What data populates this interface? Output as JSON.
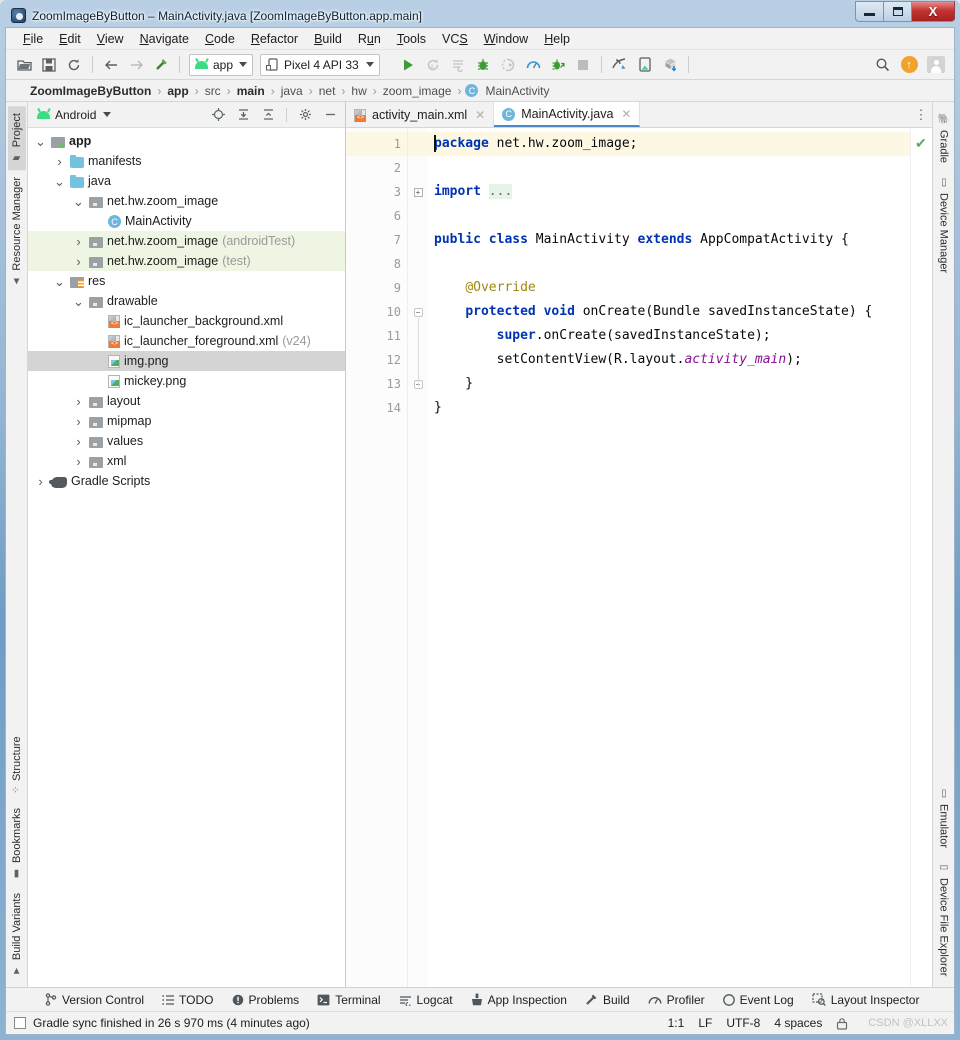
{
  "window": {
    "title": "ZoomImageByButton – MainActivity.java [ZoomImageByButton.app.main]",
    "minimize_label": "Minimize",
    "maximize_label": "Maximize",
    "close_label": "X"
  },
  "menubar": [
    {
      "label": "File",
      "mnemonic": "F"
    },
    {
      "label": "Edit",
      "mnemonic": "E"
    },
    {
      "label": "View",
      "mnemonic": "V"
    },
    {
      "label": "Navigate",
      "mnemonic": "N"
    },
    {
      "label": "Code",
      "mnemonic": "C"
    },
    {
      "label": "Refactor",
      "mnemonic": "R"
    },
    {
      "label": "Build",
      "mnemonic": "B"
    },
    {
      "label": "Run",
      "mnemonic": "u"
    },
    {
      "label": "Tools",
      "mnemonic": "T"
    },
    {
      "label": "VCS",
      "mnemonic": "S"
    },
    {
      "label": "Window",
      "mnemonic": "W"
    },
    {
      "label": "Help",
      "mnemonic": "H"
    }
  ],
  "toolbar": {
    "open_label": "Open",
    "save_label": "Save All",
    "sync_label": "Sync Project with Gradle Files",
    "back_label": "Back",
    "forward_label": "Forward",
    "build_label": "Make Project",
    "module_selector": "app",
    "device_selector": "Pixel 4 API 33",
    "run_label": "Run",
    "rerun_label": "Apply Changes",
    "logcat_label": "Attach Debugger",
    "debug_label": "Debug",
    "run_coverage_label": "Run with Coverage",
    "profile_label": "Profile",
    "attach_label": "Attach Debugger to Android Process",
    "stop_label": "Stop",
    "avd_label": "Device Manager",
    "sdk_label": "SDK Manager",
    "gradle_sync_label": "Sync Project",
    "search_label": "Search Everywhere",
    "update_label": "Update",
    "account_label": "Account"
  },
  "breadcrumb": [
    {
      "label": "ZoomImageByButton",
      "bold": true
    },
    {
      "label": "app",
      "bold": true
    },
    {
      "label": "src",
      "bold": false
    },
    {
      "label": "main",
      "bold": true
    },
    {
      "label": "java",
      "bold": false
    },
    {
      "label": "net",
      "bold": false
    },
    {
      "label": "hw",
      "bold": false
    },
    {
      "label": "zoom_image",
      "bold": false
    },
    {
      "label": "MainActivity",
      "bold": false,
      "badge": "C"
    }
  ],
  "left_rail": {
    "top": [
      {
        "label": "Project",
        "icon": "folder-icon",
        "active": true
      },
      {
        "label": "Resource Manager",
        "icon": "resource-icon",
        "active": false
      }
    ],
    "bottom": [
      {
        "label": "Structure",
        "icon": "structure-icon"
      },
      {
        "label": "Bookmarks",
        "icon": "bookmark-icon"
      },
      {
        "label": "Build Variants",
        "icon": "android-icon"
      }
    ]
  },
  "right_rail": {
    "top": [
      {
        "label": "Gradle",
        "icon": "gradle-elephant-icon"
      },
      {
        "label": "Device Manager",
        "icon": "device-icon"
      }
    ],
    "bottom": [
      {
        "label": "Emulator",
        "icon": "emulator-icon"
      },
      {
        "label": "Device File Explorer",
        "icon": "device-file-icon"
      }
    ]
  },
  "project_panel": {
    "title": "Android",
    "icon": "android-icon",
    "actions": [
      {
        "name": "select-opened-file",
        "glyph": "⊕"
      },
      {
        "name": "expand-all",
        "glyph": "⤓"
      },
      {
        "name": "collapse-all",
        "glyph": "⤒"
      },
      {
        "name": "settings",
        "glyph": "✿"
      },
      {
        "name": "hide",
        "glyph": "—"
      }
    ],
    "tree": [
      {
        "indent": 0,
        "twist": "v",
        "icon": "module",
        "label": "app",
        "bold": true,
        "suffix": "",
        "state": "none"
      },
      {
        "indent": 1,
        "twist": ">",
        "icon": "folder",
        "label": "manifests",
        "bold": false,
        "suffix": "",
        "state": "none"
      },
      {
        "indent": 1,
        "twist": "v",
        "icon": "folder",
        "label": "java",
        "bold": false,
        "suffix": "",
        "state": "none"
      },
      {
        "indent": 2,
        "twist": "v",
        "icon": "pkg",
        "label": "net.hw.zoom_image",
        "bold": false,
        "suffix": "",
        "state": "none"
      },
      {
        "indent": 3,
        "twist": "",
        "icon": "class",
        "label": "MainActivity",
        "bold": false,
        "suffix": "",
        "state": "none"
      },
      {
        "indent": 2,
        "twist": ">",
        "icon": "pkg",
        "label": "net.hw.zoom_image",
        "bold": false,
        "suffix": "(androidTest)",
        "state": "tint"
      },
      {
        "indent": 2,
        "twist": ">",
        "icon": "pkg",
        "label": "net.hw.zoom_image",
        "bold": false,
        "suffix": "(test)",
        "state": "tint"
      },
      {
        "indent": 1,
        "twist": "v",
        "icon": "res",
        "label": "res",
        "bold": false,
        "suffix": "",
        "state": "none"
      },
      {
        "indent": 2,
        "twist": "v",
        "icon": "pkg",
        "label": "drawable",
        "bold": false,
        "suffix": "",
        "state": "none"
      },
      {
        "indent": 3,
        "twist": "",
        "icon": "xml",
        "label": "ic_launcher_background.xml",
        "bold": false,
        "suffix": "",
        "state": "none"
      },
      {
        "indent": 3,
        "twist": "",
        "icon": "xml",
        "label": "ic_launcher_foreground.xml",
        "bold": false,
        "suffix": "(v24)",
        "state": "none"
      },
      {
        "indent": 3,
        "twist": "",
        "icon": "png",
        "label": "img.png",
        "bold": false,
        "suffix": "",
        "state": "sel"
      },
      {
        "indent": 3,
        "twist": "",
        "icon": "png",
        "label": "mickey.png",
        "bold": false,
        "suffix": "",
        "state": "none"
      },
      {
        "indent": 2,
        "twist": ">",
        "icon": "pkg",
        "label": "layout",
        "bold": false,
        "suffix": "",
        "state": "none"
      },
      {
        "indent": 2,
        "twist": ">",
        "icon": "pkg",
        "label": "mipmap",
        "bold": false,
        "suffix": "",
        "state": "none"
      },
      {
        "indent": 2,
        "twist": ">",
        "icon": "pkg",
        "label": "values",
        "bold": false,
        "suffix": "",
        "state": "none"
      },
      {
        "indent": 2,
        "twist": ">",
        "icon": "pkg",
        "label": "xml",
        "bold": false,
        "suffix": "",
        "state": "none"
      },
      {
        "indent": 0,
        "twist": ">",
        "icon": "gradle",
        "label": "Gradle Scripts",
        "bold": false,
        "suffix": "",
        "state": "none"
      }
    ]
  },
  "editor": {
    "tabs": [
      {
        "label": "activity_main.xml",
        "icon": "xml-file-icon",
        "active": false
      },
      {
        "label": "MainActivity.java",
        "icon": "class-icon",
        "active": true
      }
    ],
    "more_label": "⋮",
    "inspection_status": "✔",
    "lines": [
      {
        "num": "1",
        "html": "package net.hw.zoom_image;",
        "highlight": true
      },
      {
        "num": "2",
        "html": "",
        "highlight": false
      },
      {
        "num": "3",
        "html": "import ...",
        "highlight": false
      },
      {
        "num": "6",
        "html": "",
        "highlight": false
      },
      {
        "num": "7",
        "html": "public class MainActivity extends AppCompatActivity {",
        "highlight": false
      },
      {
        "num": "8",
        "html": "",
        "highlight": false
      },
      {
        "num": "9",
        "html": "    @Override",
        "highlight": false
      },
      {
        "num": "10",
        "html": "    protected void onCreate(Bundle savedInstanceState) {",
        "highlight": false
      },
      {
        "num": "11",
        "html": "        super.onCreate(savedInstanceState);",
        "highlight": false
      },
      {
        "num": "12",
        "html": "        setContentView(R.layout.activity_main);",
        "highlight": false
      },
      {
        "num": "13",
        "html": "    }",
        "highlight": false
      },
      {
        "num": "14",
        "html": "}",
        "highlight": false
      }
    ]
  },
  "bottom_bar": [
    {
      "label": "Version Control",
      "icon": "branch-icon"
    },
    {
      "label": "TODO",
      "icon": "list-icon"
    },
    {
      "label": "Problems",
      "icon": "warning-icon"
    },
    {
      "label": "Terminal",
      "icon": "terminal-icon"
    },
    {
      "label": "Logcat",
      "icon": "logcat-icon"
    },
    {
      "label": "App Inspection",
      "icon": "inspection-icon"
    },
    {
      "label": "Build",
      "icon": "hammer-icon"
    },
    {
      "label": "Profiler",
      "icon": "gauge-icon"
    },
    {
      "label": "Event Log",
      "icon": "event-icon"
    },
    {
      "label": "Layout Inspector",
      "icon": "layout-icon"
    }
  ],
  "statusbar": {
    "message": "Gradle sync finished in 26 s 970 ms (4 minutes ago)",
    "caret_position": "1:1",
    "line_separator": "LF",
    "encoding": "UTF-8",
    "indent": "4 spaces",
    "lock_icon": "🔒",
    "watermark": "CSDN @XLLXX"
  },
  "colors": {
    "accent_blue": "#4a88c7",
    "android_green": "#3ddc84",
    "keyword_blue": "#0033b3",
    "field_purple": "#871094",
    "annotation_olive": "#9e880d",
    "highlight_line": "#fdf8e4",
    "tint_green": "#eef6e3",
    "update_orange": "#f0a32c"
  }
}
